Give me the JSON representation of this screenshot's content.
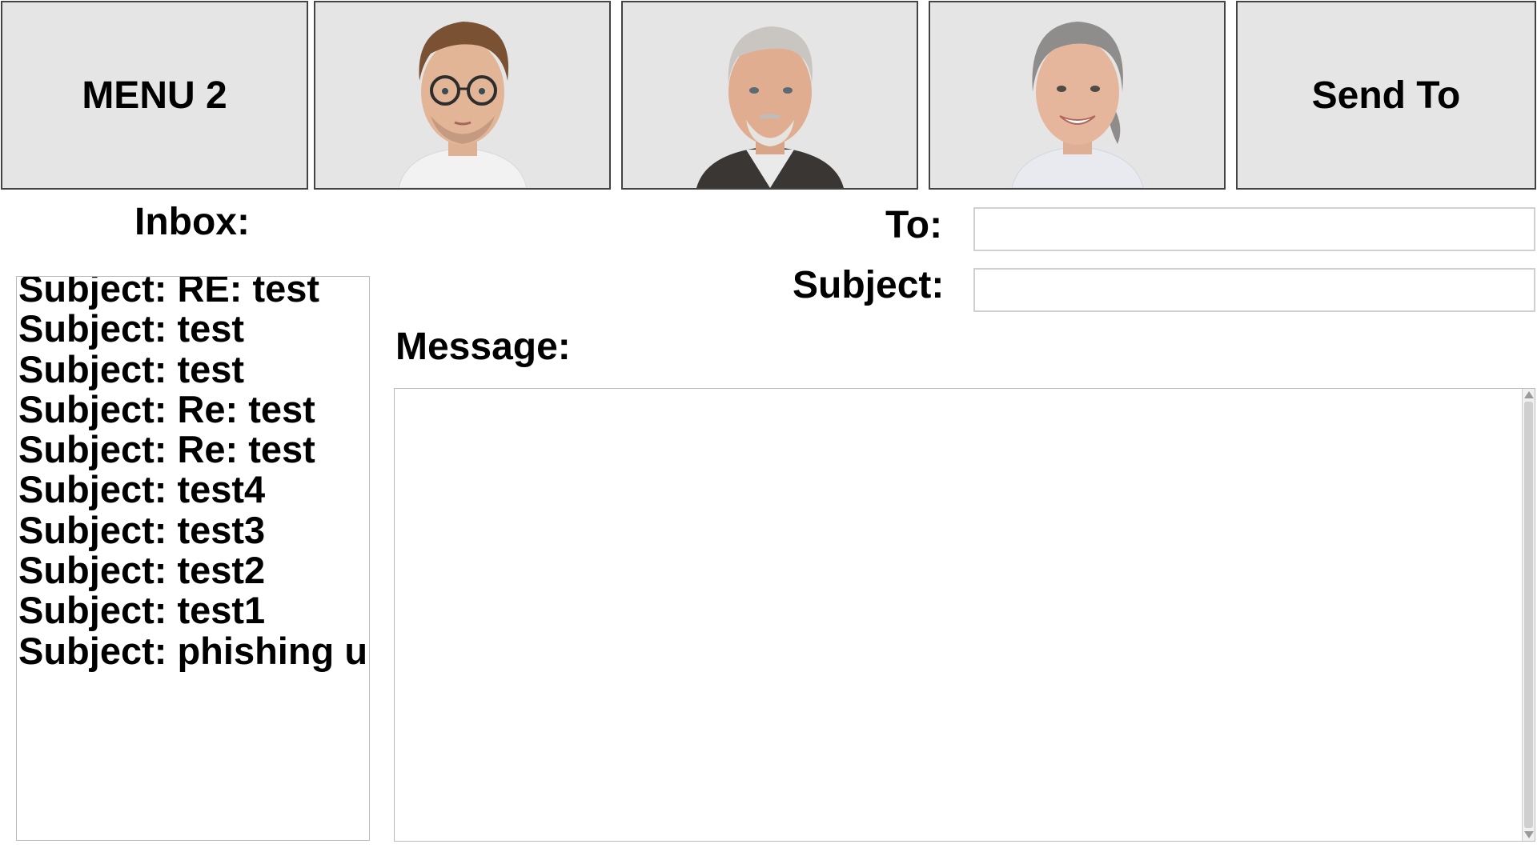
{
  "top_bar": {
    "menu_label": "MENU 2",
    "contacts": [
      {
        "icon": "avatar-young-man-glasses",
        "hair": "#7a5233",
        "skin": "#e3b597",
        "shirt": "#f2f2f2"
      },
      {
        "icon": "avatar-older-man",
        "hair": "#c9c6c2",
        "skin": "#e1ad91",
        "shirt": "#eaeaea",
        "jacket": "#3a3633"
      },
      {
        "icon": "avatar-older-woman",
        "hair": "#8f8d8b",
        "skin": "#e6b69c",
        "shirt": "#e8eaf0"
      }
    ],
    "send_label": "Send To"
  },
  "inbox": {
    "label": "Inbox:",
    "items": [
      "Subject: RE: test",
      "Subject: test",
      "Subject: test",
      "Subject: Re: test",
      "Subject: Re: test",
      "Subject: test4",
      "Subject: test3",
      "Subject: test2",
      "Subject: test1",
      "Subject: phishing u"
    ]
  },
  "compose": {
    "to_label": "To:",
    "to_value": "",
    "subject_label": "Subject:",
    "subject_value": "",
    "message_label": "Message:",
    "message_value": ""
  }
}
